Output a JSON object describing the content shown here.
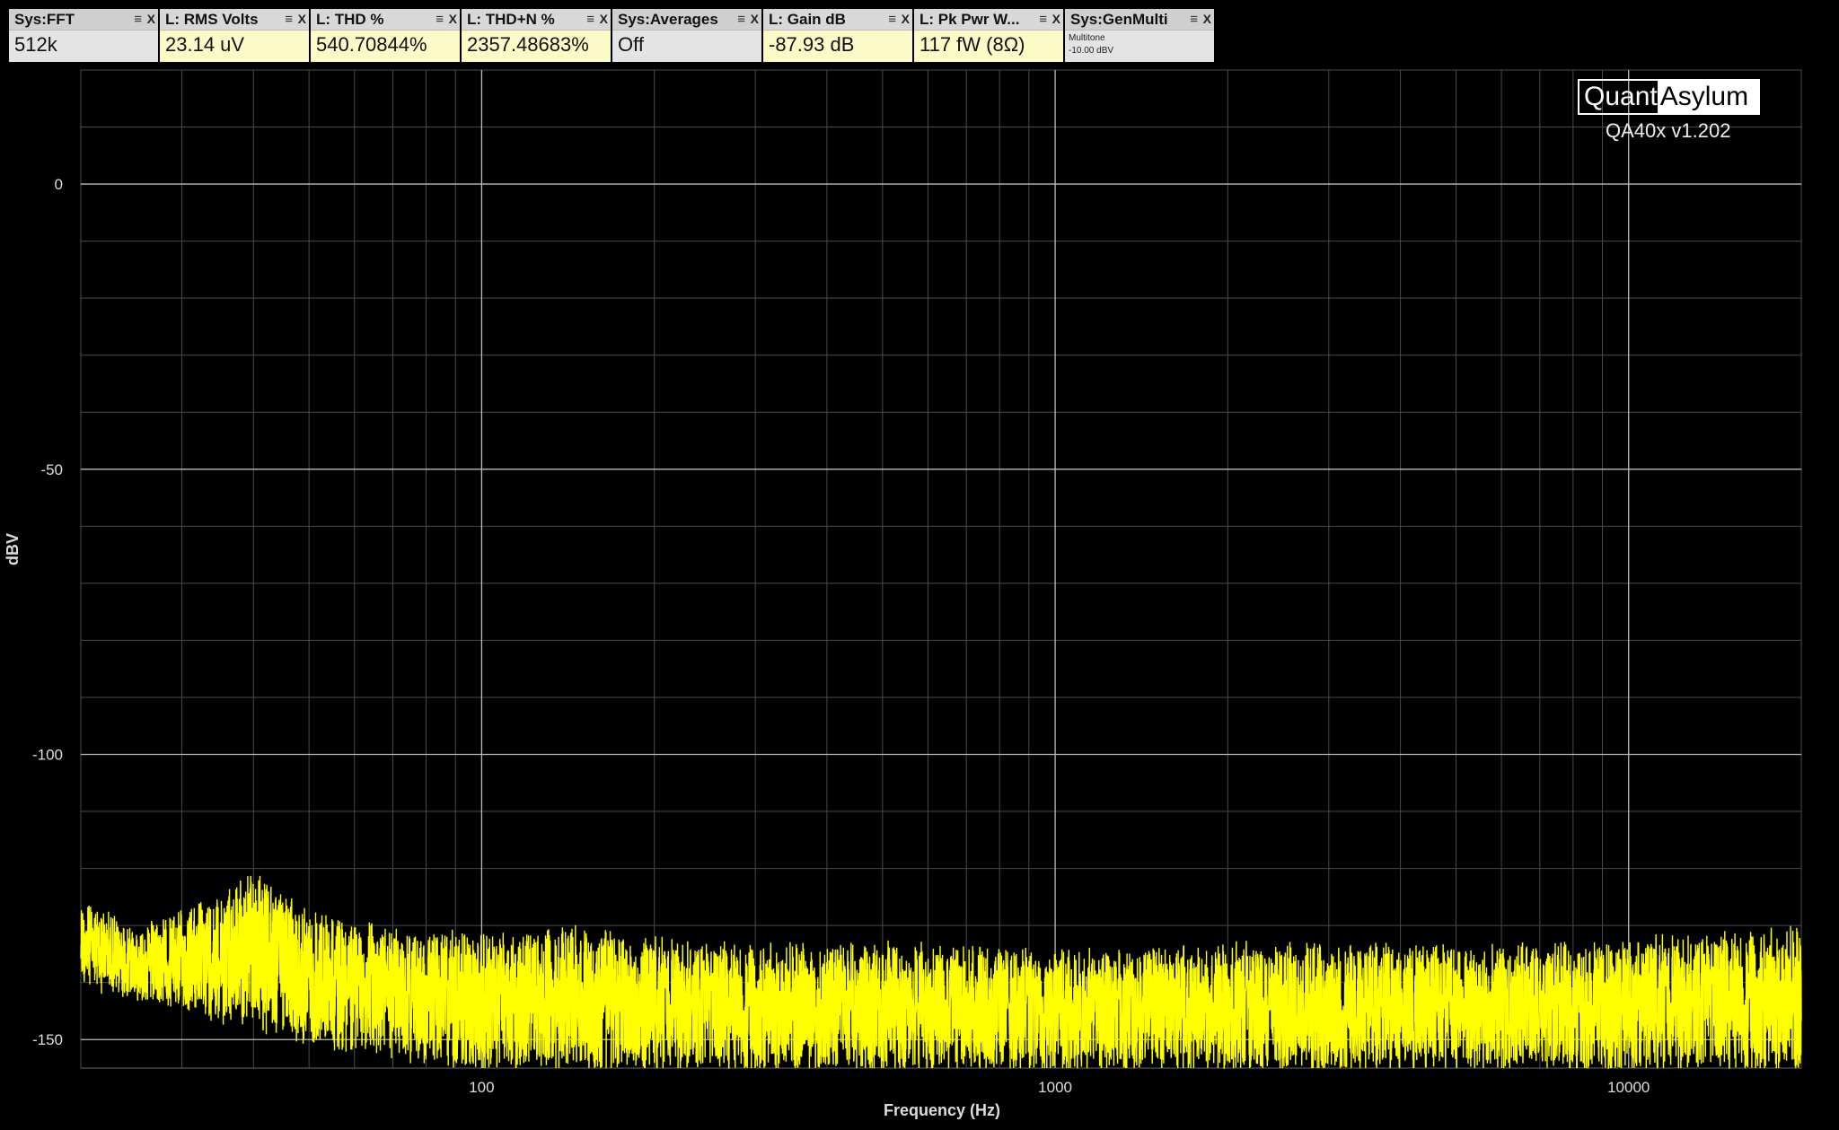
{
  "widgets": [
    {
      "title": "Sys:FFT",
      "value": "512k",
      "kind": "sys"
    },
    {
      "title": "L: RMS Volts",
      "value": "23.14 uV",
      "kind": "meas"
    },
    {
      "title": "L: THD %",
      "value": "540.70844%",
      "kind": "meas"
    },
    {
      "title": "L: THD+N %",
      "value": "2357.48683%",
      "kind": "meas"
    },
    {
      "title": "Sys:Averages",
      "value": "Off",
      "kind": "sys"
    },
    {
      "title": "L: Gain dB",
      "value": "-87.93 dB",
      "kind": "meas"
    },
    {
      "title": "L: Pk Pwr W...",
      "value": "117 fW (8Ω)",
      "kind": "meas"
    },
    {
      "title": "Sys:GenMulti",
      "line1": "Multitone",
      "line2": "-10.00 dBV",
      "kind": "sys"
    }
  ],
  "widget_menu_icon": "≡",
  "widget_close_icon": "X",
  "logo": {
    "part1": "Quant",
    "part2": "Asylum"
  },
  "version": "QA40x v1.202",
  "colors": {
    "trace": "#ffff00",
    "grid": "#4a4a4a",
    "grid_major": "#bdbdbd",
    "background": "#000000"
  },
  "chart_data": {
    "type": "line",
    "xlabel": "Frequency (Hz)",
    "ylabel": "dBV",
    "xscale": "log",
    "xlim": [
      20,
      20000
    ],
    "ylim": [
      -155,
      20
    ],
    "xticks": [
      100,
      1000,
      10000
    ],
    "xtick_labels": [
      "100",
      "1000",
      "10000"
    ],
    "yticks": [
      0,
      -50,
      -100,
      -150
    ],
    "ytick_labels": [
      "0",
      "-50",
      "-100",
      "-150"
    ],
    "grid": true,
    "series": [
      {
        "color": "#ffff00",
        "description_points": [
          [
            20,
            -126
          ],
          [
            25,
            -131
          ],
          [
            30,
            -128
          ],
          [
            40,
            -121
          ],
          [
            50,
            -128
          ],
          [
            70,
            -131
          ],
          [
            100,
            -132
          ],
          [
            150,
            -131
          ],
          [
            200,
            -133
          ],
          [
            300,
            -134
          ],
          [
            500,
            -134
          ],
          [
            1000,
            -135
          ],
          [
            2000,
            -134
          ],
          [
            5000,
            -134
          ],
          [
            10000,
            -133
          ],
          [
            20000,
            -131
          ]
        ],
        "noise_floor_min": [
          [
            20,
            -140
          ],
          [
            50,
            -150
          ],
          [
            100,
            -155
          ],
          [
            200,
            -155
          ],
          [
            500,
            -155
          ],
          [
            20000,
            -155
          ]
        ]
      }
    ]
  }
}
